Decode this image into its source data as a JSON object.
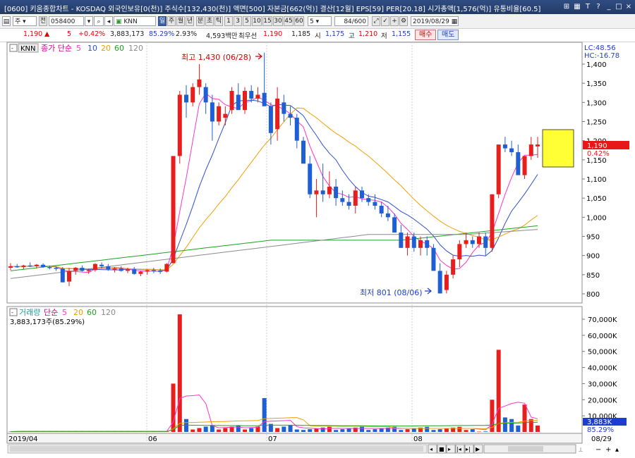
{
  "title": "[0600] 키움종합차트 - KOSDAQ 외국인보유[0(천)] 주식수[132,430(천)] 액면[500] 자본금[662(억)] 결산[12월] EPS[59] PER[20.18] 시가총액[1,576(억)] 유통비율[60.5]",
  "toolbar": {
    "jong": "주",
    "jeon": "전",
    "code": "058400",
    "name": "KNN",
    "periods": [
      "일",
      "주",
      "월",
      "년",
      "분",
      "초",
      "틱"
    ],
    "minutes": [
      "1",
      "3",
      "5",
      "10",
      "15",
      "30",
      "45",
      "60"
    ],
    "tick_count": "5",
    "data_count": "84",
    "data_max": "/600",
    "date": "2019/08/29"
  },
  "quote": {
    "price": "1,190",
    "change": "5",
    "change_pct": "+0.42%",
    "volume": "3,883,173",
    "vol_ratio": "85.29%",
    "turnover": "2.93%",
    "amount": "4,593백만",
    "priority_label": "최우선",
    "priority_value": "1,190",
    "prev": "1,185",
    "open_label": "시",
    "open": "1,175",
    "high_label": "고",
    "high": "1,210",
    "low_label": "저",
    "low": "1,155",
    "buy": "매수",
    "sell": "매도"
  },
  "price_panel": {
    "legend_name": "KNN",
    "legend_ma_label": "종가 단순",
    "ma_periods": [
      "5",
      "10",
      "20",
      "60",
      "120"
    ],
    "lc": "LC:48.56",
    "hc": "HC:-16.78",
    "last_price": "1,190",
    "last_pct": "0.42%",
    "high_note": "최고 1,430 (06/28)",
    "low_note": "최저 801 (08/06)",
    "y_ticks": [
      "1,400",
      "1,350",
      "1,300",
      "1,250",
      "1,200",
      "1,150",
      "1,100",
      "1,050",
      "1,000",
      "950",
      "900",
      "850",
      "800"
    ]
  },
  "volume_panel": {
    "legend_label": "거래량",
    "legend_ma_label": "단순",
    "ma_periods": [
      "5",
      "20",
      "60",
      "120"
    ],
    "summary": "3,883,173주(85.29%)",
    "last_volume": "3,883K",
    "last_pct": "85.29%",
    "y_ticks": [
      "70,000K",
      "60,000K",
      "50,000K",
      "40,000K",
      "30,000K",
      "20,000K",
      "10,000K"
    ]
  },
  "x_axis": {
    "labels": [
      "2019/04",
      "06",
      "07",
      "08"
    ],
    "right_label": "08/29"
  },
  "colors": {
    "up": "#e61e1e",
    "down": "#1f5fd6",
    "ma5": "#ff33cc",
    "ma10": "#2e4fd0",
    "ma20": "#f0a000",
    "ma60": "#1fa01f",
    "ma120": "#8a8a8a"
  }
}
